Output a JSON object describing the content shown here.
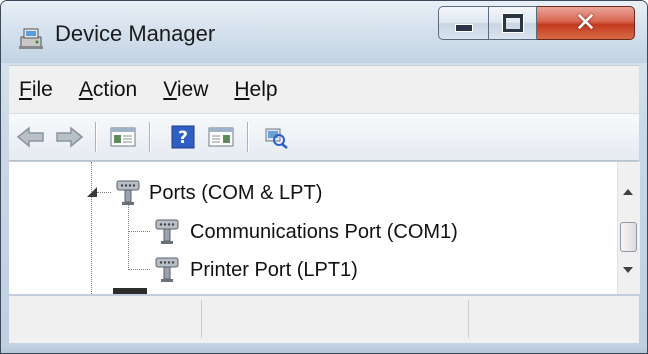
{
  "window": {
    "title": "Device Manager",
    "icon": "device-manager-icon",
    "controls": {
      "minimize": "minimize-icon",
      "maximize": "maximize-icon",
      "close": "✕"
    }
  },
  "menubar": {
    "items": [
      {
        "label_acc": "F",
        "label_rest": "ile"
      },
      {
        "label_acc": "A",
        "label_rest": "ction"
      },
      {
        "label_acc": "V",
        "label_rest": "iew"
      },
      {
        "label_acc": "H",
        "label_rest": "elp"
      }
    ]
  },
  "toolbar": {
    "buttons": [
      "back-arrow-icon",
      "forward-arrow-icon",
      "show-hide-console-tree-icon",
      "help-icon",
      "action-pane-icon",
      "scan-hardware-icon"
    ]
  },
  "tree": {
    "category": {
      "label": "Ports (COM & LPT)",
      "icon": "port-icon",
      "expanded": true
    },
    "children": [
      {
        "label": "Communications Port (COM1)",
        "icon": "port-icon"
      },
      {
        "label": "Printer Port (LPT1)",
        "icon": "port-icon"
      }
    ]
  },
  "colors": {
    "title_bar": "#d6e2ee",
    "close_button": "#c23a1f",
    "menu_background": "#f0f0f0"
  }
}
